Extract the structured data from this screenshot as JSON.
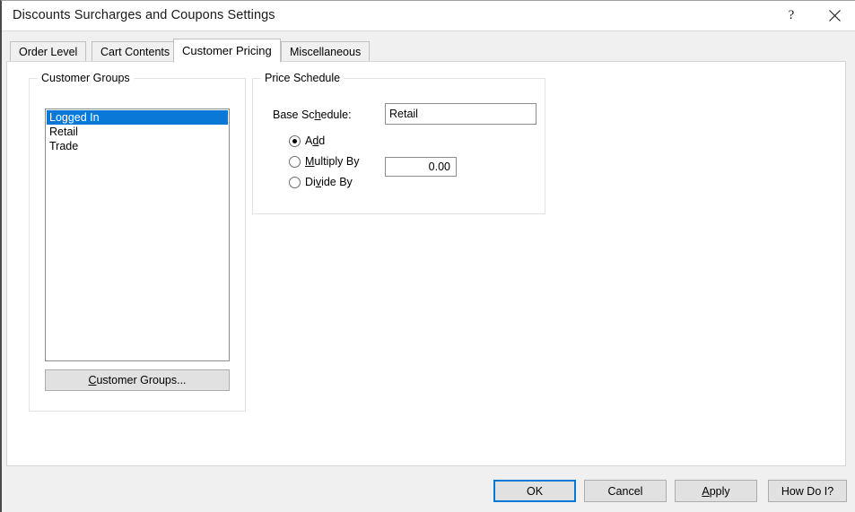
{
  "window": {
    "title": "Discounts Surcharges and Coupons Settings",
    "help_button": "?",
    "close_button": "close-icon"
  },
  "tabs": [
    {
      "label": "Order Level",
      "active": false
    },
    {
      "label": "Cart Contents",
      "active": false
    },
    {
      "label": "Customer Pricing",
      "active": true
    },
    {
      "label": "Miscellaneous",
      "active": false
    }
  ],
  "customer_groups": {
    "group_label": "Customer Groups",
    "items": [
      {
        "label": "Logged In",
        "selected": true
      },
      {
        "label": "Retail",
        "selected": false
      },
      {
        "label": "Trade",
        "selected": false
      }
    ],
    "button_label": "Customer Groups...",
    "button_accel": "C"
  },
  "price_schedule": {
    "group_label": "Price Schedule",
    "base_schedule_label": "Base Schedule:",
    "base_schedule_accel": "h",
    "base_schedule_value": "Retail",
    "base_schedule_placeholder": "",
    "options": [
      {
        "label": "Add",
        "accel": "d",
        "checked": true
      },
      {
        "label": "Multiply By",
        "accel": "M",
        "checked": false
      },
      {
        "label": "Divide By",
        "accel": "v",
        "checked": false
      }
    ],
    "amount_value": "0.00",
    "amount_placeholder": ""
  },
  "footer": {
    "ok_label": "OK",
    "cancel_label": "Cancel",
    "apply_label": "Apply",
    "apply_accel": "A",
    "how_do_i_label": "How Do I?"
  },
  "colors": {
    "selection_blue": "#0a78d7",
    "focus_blue": "#0078d7",
    "dialog_grey": "#f0f0f0",
    "panel_white": "#ffffff"
  }
}
